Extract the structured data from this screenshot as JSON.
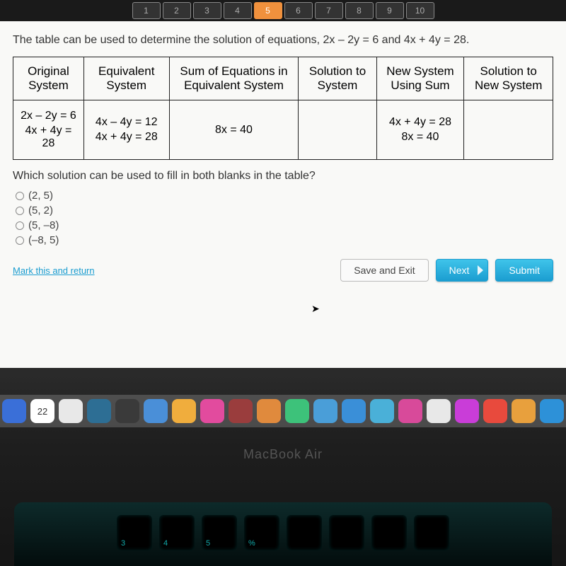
{
  "nav": {
    "items": [
      "1",
      "2",
      "3",
      "4",
      "5",
      "6",
      "7",
      "8",
      "9",
      "10"
    ],
    "active_index": 4
  },
  "question": "The table can be used to determine the solution of equations, 2x – 2y = 6 and 4x + 4y = 28.",
  "table": {
    "headers": [
      "Original System",
      "Equivalent System",
      "Sum of Equations in Equivalent System",
      "Solution to System",
      "New System Using Sum",
      "Solution to New System"
    ],
    "row": {
      "original": [
        "2x – 2y = 6",
        "4x + 4y = 28"
      ],
      "equivalent": [
        "4x – 4y = 12",
        "4x + 4y = 28"
      ],
      "sum": "8x = 40",
      "solution": "",
      "new_system": [
        "4x + 4y = 28",
        "8x = 40"
      ],
      "new_solution": ""
    }
  },
  "sub_question": "Which solution can be used to fill in both blanks in the table?",
  "options": [
    "(2, 5)",
    "(5, 2)",
    "(5, –8)",
    "(–8, 5)"
  ],
  "footer": {
    "mark": "Mark this and return",
    "save": "Save and Exit",
    "next": "Next",
    "submit": "Submit"
  },
  "laptop": "MacBook Air",
  "dock_colors": [
    "#8e4b3a",
    "#3a6fd8",
    "#e03d3d",
    "#e8e8e8",
    "#2d6e94",
    "#3a3a3a",
    "#4a8fd8",
    "#f0ad3d",
    "#e24b9e",
    "#9a3d3d",
    "#e08a3d",
    "#3dc27a",
    "#4a9ed8",
    "#3a8fd8",
    "#4ab0d8",
    "#d84a9a",
    "#e8e8e8",
    "#c93dd8",
    "#e84a3d",
    "#e8a03d",
    "#2d91d8",
    "#3a3a3a"
  ],
  "dock_badge": "22",
  "keys": [
    "3",
    "4",
    "5",
    "%",
    "",
    "",
    "",
    ""
  ]
}
